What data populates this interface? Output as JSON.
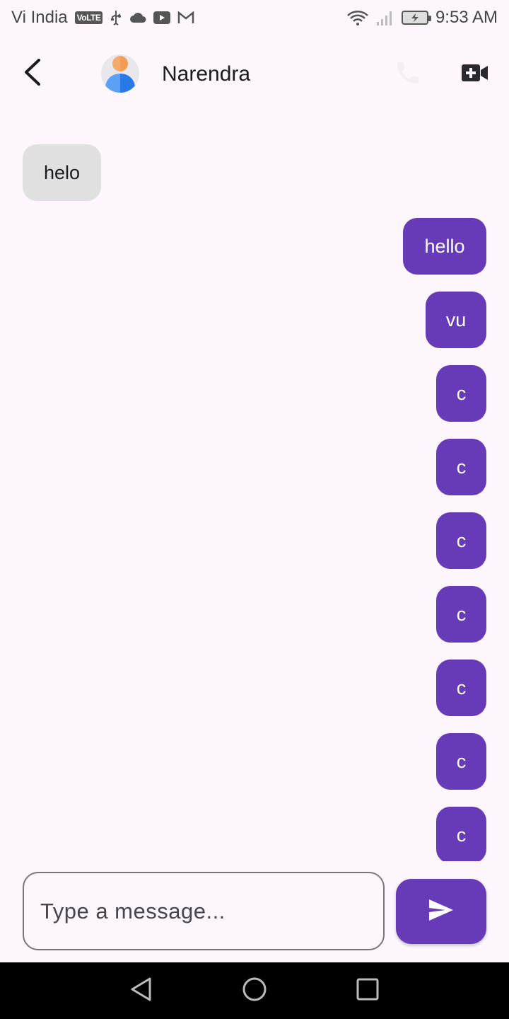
{
  "status_bar": {
    "carrier": "Vi India",
    "volte": "VoLTE",
    "time": "9:53 AM"
  },
  "header": {
    "contact_name": "Narendra",
    "icons": [
      "back-arrow-icon",
      "avatar-icon",
      "phone-icon",
      "video-call-icon"
    ]
  },
  "messages": [
    {
      "direction": "received",
      "text": "helo"
    },
    {
      "direction": "sent",
      "text": "hello"
    },
    {
      "direction": "sent",
      "text": "vu"
    },
    {
      "direction": "sent",
      "text": "c"
    },
    {
      "direction": "sent",
      "text": "c"
    },
    {
      "direction": "sent",
      "text": "c"
    },
    {
      "direction": "sent",
      "text": "c"
    },
    {
      "direction": "sent",
      "text": "c"
    },
    {
      "direction": "sent",
      "text": "c"
    },
    {
      "direction": "sent",
      "text": "c"
    }
  ],
  "composer": {
    "placeholder": "Type a message...",
    "value": "",
    "send_icon": "send-icon"
  },
  "colors": {
    "accent": "#673ab7",
    "received_bubble": "#e0e0e0",
    "background": "#fdf7fd"
  }
}
